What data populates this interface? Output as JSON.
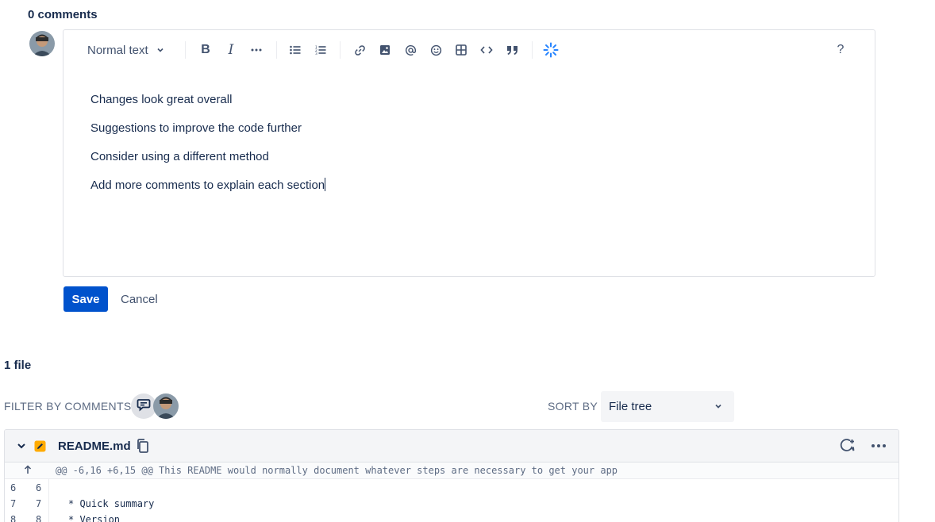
{
  "comments": {
    "title": "0 comments"
  },
  "editor": {
    "toolbar": {
      "text_style": "Normal text",
      "help_label": "?"
    },
    "content": [
      "Changes look great overall",
      "Suggestions to improve the code further",
      "Consider using a different method",
      "Add more comments to explain each section"
    ]
  },
  "actions": {
    "save_label": "Save",
    "cancel_label": "Cancel"
  },
  "files": {
    "title": "1 file",
    "filter_label": "FILTER BY COMMENTS",
    "sort_label": "SORT BY",
    "sort_value": "File tree"
  },
  "diff": {
    "filename": "README.md",
    "hunk_header": "@@ -6,16 +6,15 @@ This README would normally document whatever steps are necessary to get your app",
    "lines": [
      {
        "old": "6",
        "new": "6",
        "code": ""
      },
      {
        "old": "7",
        "new": "7",
        "code": "* Quick summary"
      },
      {
        "old": "8",
        "new": "8",
        "code": "* Version"
      }
    ]
  },
  "colors": {
    "primary": "#0052cc",
    "text": "#172b4d",
    "subtle_text": "#5e6c84",
    "border": "#dfe1e6",
    "ai_accent": "#2684ff"
  }
}
